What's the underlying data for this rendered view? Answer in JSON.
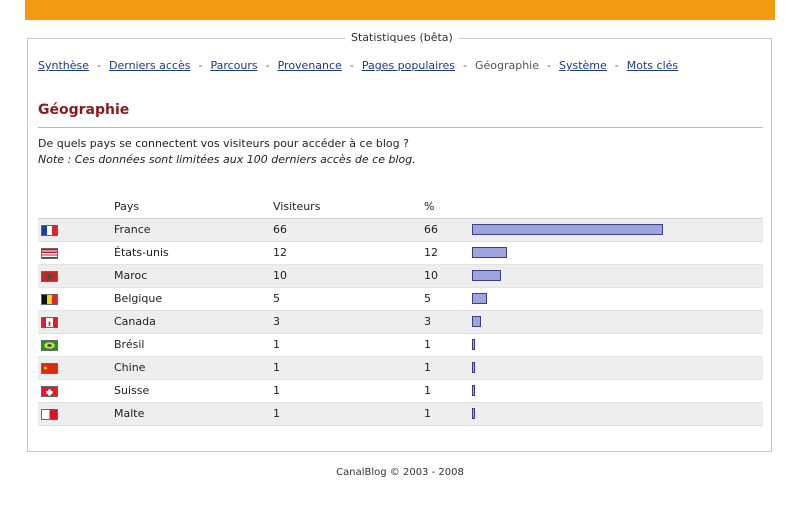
{
  "panel": {
    "title": "Statistiques (bêta)"
  },
  "nav": [
    {
      "label": "Synthèse",
      "current": false
    },
    {
      "label": "Derniers accès",
      "current": false
    },
    {
      "label": "Parcours",
      "current": false
    },
    {
      "label": "Provenance",
      "current": false
    },
    {
      "label": "Pages populaires",
      "current": false
    },
    {
      "label": "Géographie",
      "current": true
    },
    {
      "label": "Système",
      "current": false
    },
    {
      "label": "Mots clés",
      "current": false
    }
  ],
  "nav_separator": "-",
  "page": {
    "heading": "Géographie",
    "question": "De quels pays se connectent vos visiteurs pour accéder à ce blog ?",
    "note": "Note : Ces données sont limitées aux 100 derniers accès de ce blog."
  },
  "table": {
    "headers": {
      "pays": "Pays",
      "visiteurs": "Visiteurs",
      "pct": "%"
    },
    "rows": [
      {
        "flag": "france-flag",
        "pays": "France",
        "visiteurs": "66",
        "pct": "66",
        "share": 66
      },
      {
        "flag": "usa-flag",
        "pays": "États-unis",
        "visiteurs": "12",
        "pct": "12",
        "share": 12
      },
      {
        "flag": "morocco-flag",
        "pays": "Maroc",
        "visiteurs": "10",
        "pct": "10",
        "share": 10
      },
      {
        "flag": "belgium-flag",
        "pays": "Belgique",
        "visiteurs": "5",
        "pct": "5",
        "share": 5
      },
      {
        "flag": "canada-flag",
        "pays": "Canada",
        "visiteurs": "3",
        "pct": "3",
        "share": 3
      },
      {
        "flag": "brazil-flag",
        "pays": "Brésil",
        "visiteurs": "1",
        "pct": "1",
        "share": 1
      },
      {
        "flag": "china-flag",
        "pays": "Chine",
        "visiteurs": "1",
        "pct": "1",
        "share": 1
      },
      {
        "flag": "switzerland-flag",
        "pays": "Suisse",
        "visiteurs": "1",
        "pct": "1",
        "share": 1
      },
      {
        "flag": "malta-flag",
        "pays": "Malte",
        "visiteurs": "1",
        "pct": "1",
        "share": 1
      }
    ]
  },
  "footer": {
    "text": "CanalBlog © 2003 - 2008"
  },
  "colors": {
    "accent_bar": "#f39a12",
    "heading": "#8b1a1a",
    "link": "#1d3a8a",
    "bar_fill": "#9ea3dc",
    "bar_border": "#3b3f87"
  }
}
